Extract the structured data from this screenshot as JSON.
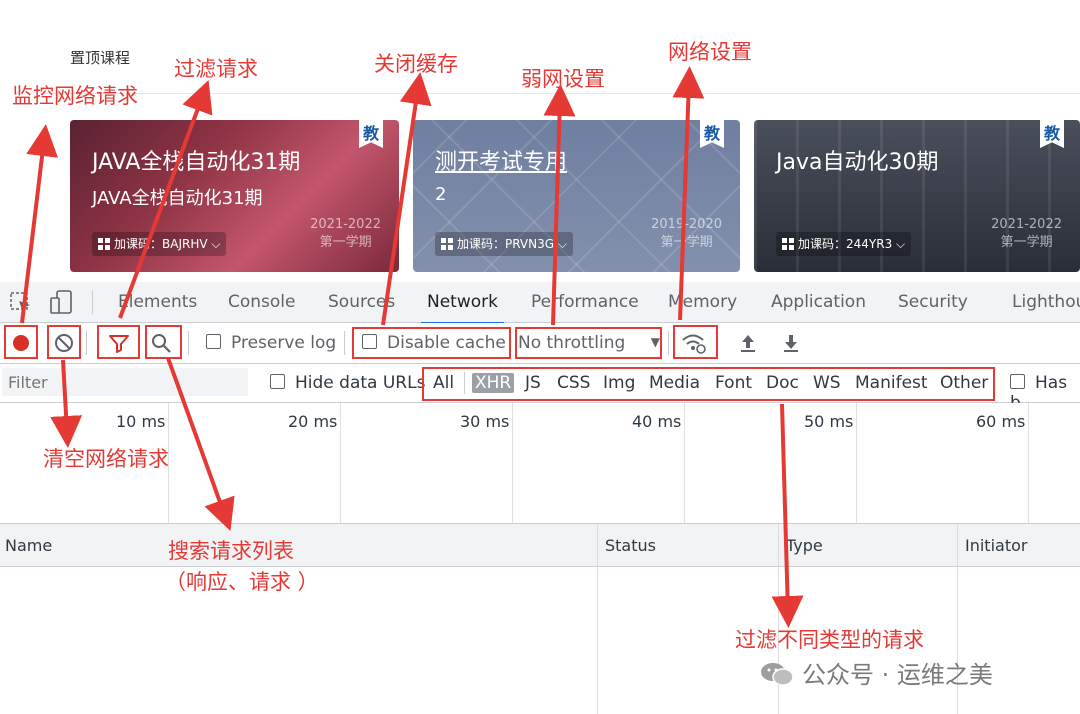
{
  "page": {
    "section_title": "置顶课程",
    "cards": [
      {
        "title": "JAVA全栈自动化31期",
        "subtitle": "JAVA全栈自动化31期",
        "badge": "教",
        "code": "加课码：BAJRHV",
        "year": "2021-2022",
        "term": "第一学期"
      },
      {
        "title": "测开考试专用",
        "subtitle": "2",
        "badge": "教",
        "code": "加课码：PRVN3G",
        "year": "2019-2020",
        "term": "第一学期"
      },
      {
        "title": "Java自动化30期",
        "subtitle": "",
        "badge": "教",
        "code": "加课码：244YR3",
        "year": "2021-2022",
        "term": "第一学期"
      }
    ]
  },
  "devtools": {
    "tabs": [
      "Elements",
      "Console",
      "Sources",
      "Network",
      "Performance",
      "Memory",
      "Application",
      "Security",
      "Lighthou"
    ],
    "active_tab": "Network",
    "toolbar": {
      "preserve_log": "Preserve log",
      "disable_cache": "Disable cache",
      "throttling": "No throttling"
    },
    "filter": {
      "placeholder": "Filter",
      "hide_data_urls": "Hide data URLs",
      "types": [
        "All",
        "XHR",
        "JS",
        "CSS",
        "Img",
        "Media",
        "Font",
        "Doc",
        "WS",
        "Manifest",
        "Other"
      ],
      "selected_type": "XHR",
      "has_blocked": "Has b"
    },
    "timeline_ticks": [
      "10 ms",
      "20 ms",
      "30 ms",
      "40 ms",
      "50 ms",
      "60 ms"
    ],
    "columns": [
      "Name",
      "Status",
      "Type",
      "Initiator"
    ]
  },
  "annotations": {
    "monitor": "监控网络请求",
    "filter_req": "过滤请求",
    "close_cache": "关闭缓存",
    "weak_network": "弱网设置",
    "network_settings": "网络设置",
    "clear": "清空网络请求",
    "search_line1": "搜索请求列表",
    "search_line2": "（响应、请求 ）",
    "filter_types": "过滤不同类型的请求"
  },
  "watermark": "公众号 · 运维之美",
  "colors": {
    "annotation_red": "#e53935",
    "record_red": "#d93025",
    "active_tab_blue": "#1a73e8"
  }
}
